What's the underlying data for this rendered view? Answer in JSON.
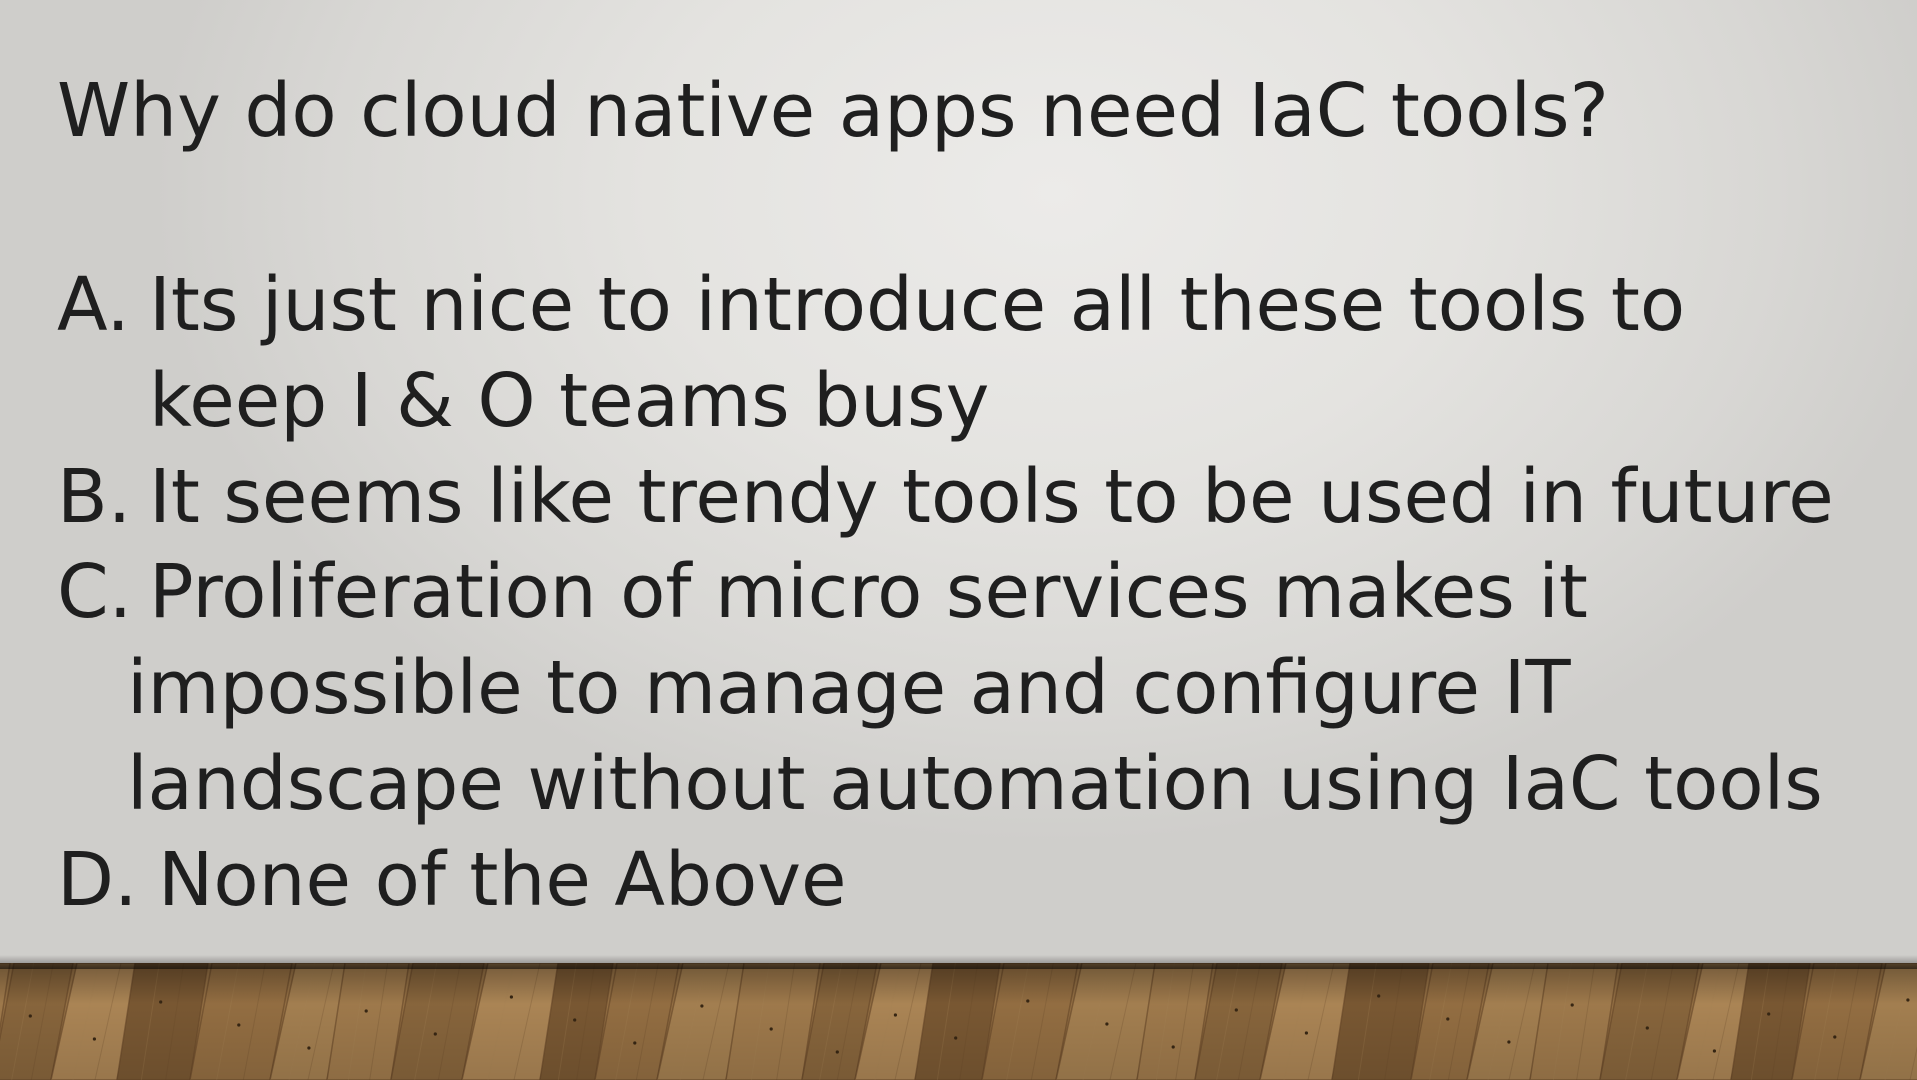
{
  "slide": {
    "question": "Why do cloud native apps need IaC tools?",
    "options": [
      {
        "letter": "A.",
        "lines": [
          "Its just nice to introduce all these tools to",
          "keep I & O teams busy"
        ]
      },
      {
        "letter": "B.",
        "lines": [
          "It seems like trendy tools to be used in future"
        ]
      },
      {
        "letter": "C.",
        "lines": [
          "Proliferation of micro services makes it",
          "impossible to manage and configure IT",
          "landscape without automation using IaC tools"
        ]
      },
      {
        "letter": "D.",
        "lines": [
          "None of the Above"
        ]
      }
    ]
  },
  "colors": {
    "text": "#1f1f1f",
    "wall": "#e6e5e2",
    "floor_light": "#b08a5a",
    "floor_dark": "#6b4a2a"
  }
}
